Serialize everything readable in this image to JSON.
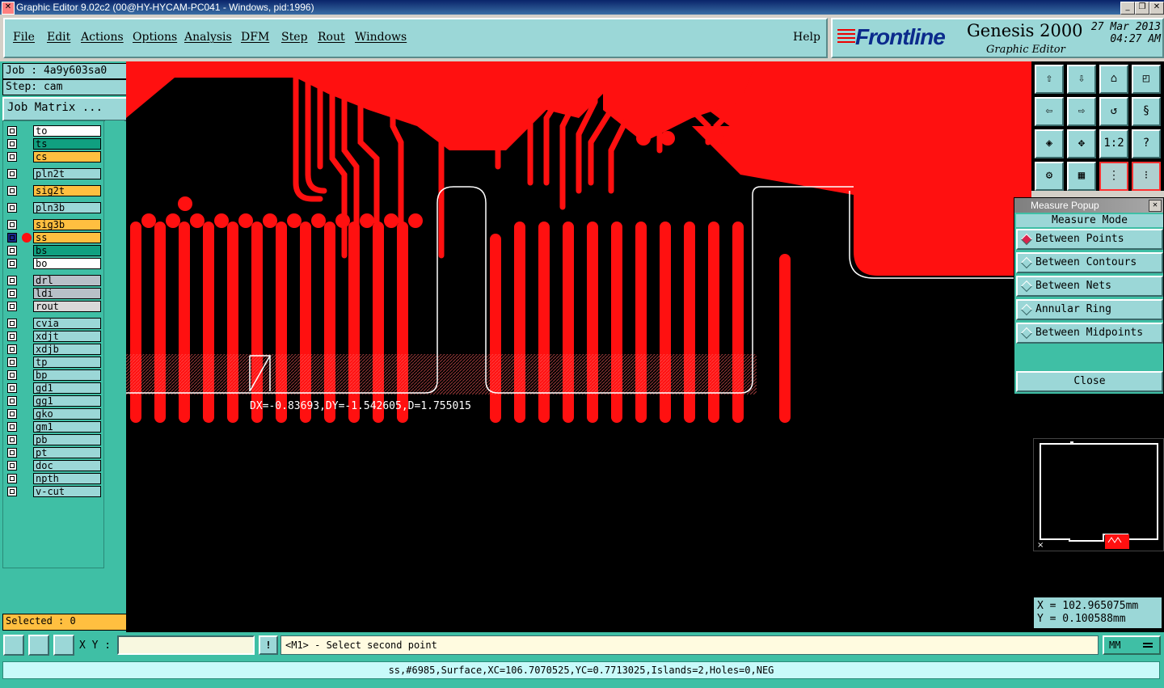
{
  "window": {
    "title": "Graphic Editor 9.02c2 (00@HY-HYCAM-PC041 - Windows, pid:1996)"
  },
  "menu": {
    "items": [
      "File",
      "Edit",
      "Actions",
      "Options",
      "Analysis",
      "DFM",
      "Step",
      "Rout",
      "Windows"
    ],
    "help": "Help"
  },
  "brand": {
    "logo": "Frontline",
    "product": "Genesis 2000",
    "subtitle": "Graphic Editor",
    "date": "27 Mar 2013",
    "time": "04:27 AM"
  },
  "job": {
    "job_label": "Job : 4a9y603sa0",
    "step_label": "Step: cam",
    "matrix_button": "Job Matrix ..."
  },
  "layers": [
    {
      "name": "to",
      "color": "#ffffff"
    },
    {
      "name": "ts",
      "color": "#10a080"
    },
    {
      "name": "cs",
      "color": "#ffbf40"
    },
    {
      "name": "pln2t",
      "color": "#9bd7d7"
    },
    {
      "name": "sig2t",
      "color": "#ffbf40"
    },
    {
      "name": "pln3b",
      "color": "#9bd7d7"
    },
    {
      "name": "sig3b",
      "color": "#ffbf40"
    },
    {
      "name": "ss",
      "color": "#ffbf40"
    },
    {
      "name": "bs",
      "color": "#10a080"
    },
    {
      "name": "bo",
      "color": "#ffffff"
    },
    {
      "name": "drl",
      "color": "#b8c0c8"
    },
    {
      "name": "ldi",
      "color": "#b8c0c8"
    },
    {
      "name": "rout",
      "color": "#d8d8d8"
    },
    {
      "name": "cvia",
      "color": "#9bd7d7"
    },
    {
      "name": "xdjt",
      "color": "#9bd7d7"
    },
    {
      "name": "xdjb",
      "color": "#9bd7d7"
    },
    {
      "name": "tp",
      "color": "#9bd7d7"
    },
    {
      "name": "bp",
      "color": "#9bd7d7"
    },
    {
      "name": "gd1",
      "color": "#9bd7d7"
    },
    {
      "name": "gg1",
      "color": "#9bd7d7"
    },
    {
      "name": "gko",
      "color": "#9bd7d7"
    },
    {
      "name": "gm1",
      "color": "#9bd7d7"
    },
    {
      "name": "pb",
      "color": "#9bd7d7"
    },
    {
      "name": "pt",
      "color": "#9bd7d7"
    },
    {
      "name": "doc",
      "color": "#9bd7d7"
    },
    {
      "name": "npth",
      "color": "#9bd7d7"
    },
    {
      "name": "v-cut",
      "color": "#9bd7d7"
    }
  ],
  "selected": "Selected : 0",
  "measure": {
    "readout": "DX=-0.83693,DY=-1.542605,D=1.755015"
  },
  "measure_popup": {
    "title": "Measure Popup",
    "mode_label": "Measure Mode",
    "options": [
      "Between Points",
      "Between Contours",
      "Between Nets",
      "Annular Ring",
      "Between Midpoints"
    ],
    "selected_option": "Between Points",
    "close": "Close"
  },
  "toolbar": {
    "ratio_label": "1:2",
    "help_label": "?"
  },
  "coords": {
    "x": "X = 102.965075mm",
    "y": "Y = 0.100588mm"
  },
  "command": {
    "xy_label": "X Y :",
    "xy_value": "",
    "excl": "!",
    "prompt": "<M1> - Select second point",
    "unit": "MM"
  },
  "status": "ss,#6985,Surface,XC=106.7070525,YC=0.7713025,Islands=2,Holes=0,NEG",
  "colors": {
    "copper": "#ff1010",
    "panel": "#3fbfa5",
    "widget": "#9bd7d7"
  }
}
